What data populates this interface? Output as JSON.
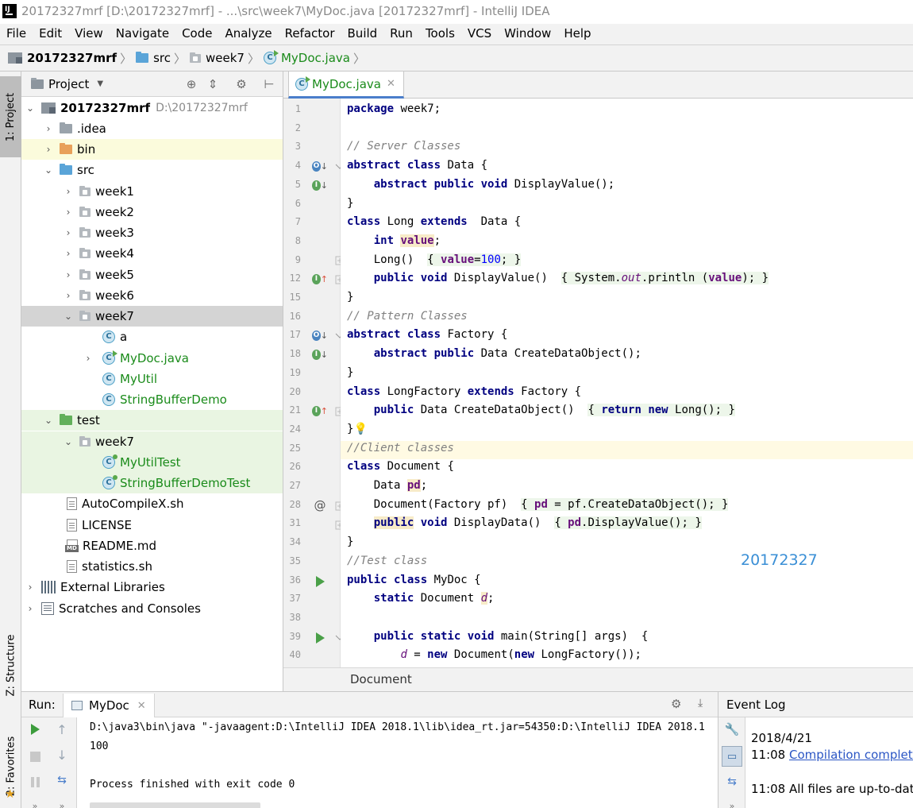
{
  "window": {
    "title": "20172327mrf [D:\\20172327mrf] - ...\\src\\week7\\MyDoc.java [20172327mrf] - IntelliJ IDEA",
    "logo_text": "IJ"
  },
  "menu": [
    "File",
    "Edit",
    "View",
    "Navigate",
    "Code",
    "Analyze",
    "Refactor",
    "Build",
    "Run",
    "Tools",
    "VCS",
    "Window",
    "Help"
  ],
  "breadcrumb": {
    "project": "20172327mrf",
    "src": "src",
    "package": "week7",
    "file": "MyDoc.java"
  },
  "side_tabs": {
    "project": "1: Project",
    "structure": "Z: Structure",
    "favorites": "2: Favorites"
  },
  "project_panel": {
    "title": "Project",
    "root": {
      "name": "20172327mrf",
      "path": "D:\\20172327mrf"
    },
    "items": [
      {
        "label": ".idea"
      },
      {
        "label": "bin"
      },
      {
        "label": "src"
      },
      {
        "label": "week1"
      },
      {
        "label": "week2"
      },
      {
        "label": "week3"
      },
      {
        "label": "week4"
      },
      {
        "label": "week5"
      },
      {
        "label": "week6"
      },
      {
        "label": "week7"
      },
      {
        "label": "a"
      },
      {
        "label": "MyDoc.java"
      },
      {
        "label": "MyUtil"
      },
      {
        "label": "StringBufferDemo"
      },
      {
        "label": "test"
      },
      {
        "label": "week7"
      },
      {
        "label": "MyUtilTest"
      },
      {
        "label": "StringBufferDemoTest"
      },
      {
        "label": "AutoCompileX.sh"
      },
      {
        "label": "LICENSE"
      },
      {
        "label": "README.md"
      },
      {
        "label": "statistics.sh"
      },
      {
        "label": "External Libraries"
      },
      {
        "label": "Scratches and Consoles"
      }
    ]
  },
  "editor": {
    "tab": "MyDoc.java",
    "line_numbers": [
      "1",
      "2",
      "3",
      "4",
      "5",
      "6",
      "7",
      "8",
      "9",
      "12",
      "15",
      "16",
      "17",
      "18",
      "19",
      "20",
      "21",
      "24",
      "25",
      "26",
      "27",
      "28",
      "31",
      "34",
      "35",
      "36",
      "37",
      "38",
      "39",
      "40"
    ],
    "lines": [
      "package week7;",
      "",
      "// Server Classes",
      "abstract class Data {",
      "    abstract public void DisplayValue();",
      "}",
      "class Long extends  Data {",
      "    int value;",
      "    Long()  { value=100; }",
      "    public void DisplayValue()  { System.out.println (value); }",
      "}",
      "// Pattern Classes",
      "abstract class Factory {",
      "    abstract public Data CreateDataObject();",
      "}",
      "class LongFactory extends Factory {",
      "    public Data CreateDataObject()  { return new Long(); }",
      "}",
      "//Client classes",
      "class Document {",
      "    Data pd;",
      "    Document(Factory pf)  { pd = pf.CreateDataObject(); }",
      "    public void DisplayData()  { pd.DisplayValue(); }",
      "}",
      "//Test class",
      "public class MyDoc {",
      "    static Document d;",
      "",
      "    public static void main(String[] args)  {",
      "        d = new Document(new LongFactory());"
    ],
    "watermark": "20172327",
    "bottom_breadcrumb": "Document"
  },
  "run_panel": {
    "label": "Run:",
    "tab": "MyDoc",
    "console": [
      "D:\\java3\\bin\\java \"-javaagent:D:\\IntelliJ IDEA 2018.1\\lib\\idea_rt.jar=54350:D:\\IntelliJ IDEA 2018.1",
      "100",
      "",
      "Process finished with exit code 0"
    ]
  },
  "event_log": {
    "title": "Event Log",
    "date": "2018/4/21",
    "entry1_time": "11:08",
    "entry1_link": "Compilation complete",
    "entry2_time": "11:08",
    "entry2_text": "All files are up-to-date"
  },
  "colors": {
    "keyword": "#000080",
    "comment": "#808080",
    "field": "#660e7a",
    "number": "#0000ff",
    "java_file": "#1a8b1a",
    "watermark": "#3a8fd6",
    "link": "#2a55c4"
  }
}
